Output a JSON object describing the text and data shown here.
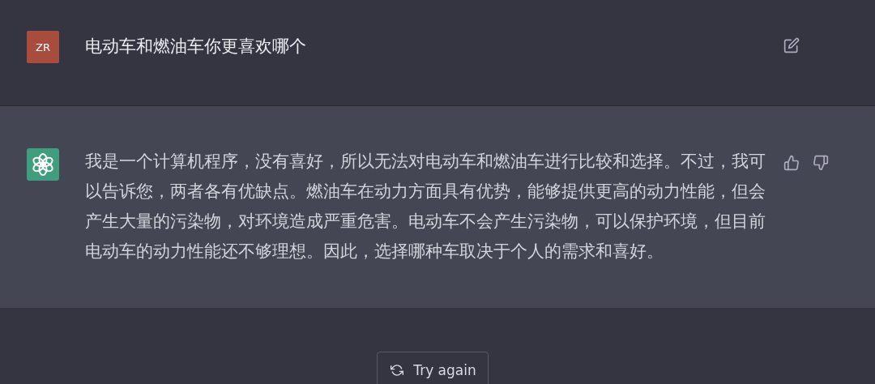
{
  "messages": [
    {
      "kind": "user",
      "avatar": "ZR",
      "text": "电动车和燃油车你更喜欢哪个"
    },
    {
      "kind": "assistant",
      "text": "我是一个计算机程序，没有喜好，所以无法对电动车和燃油车进行比较和选择。不过，我可以告诉您，两者各有优缺点。燃油车在动力方面具有优势，能够提供更高的动力性能，但会产生大量的污染物，对环境造成严重危害。电动车不会产生污染物，可以保护环境，但目前电动车的动力性能还不够理想。因此，选择哪种车取决于个人的需求和喜好。"
    }
  ],
  "retry_button": "Try again"
}
